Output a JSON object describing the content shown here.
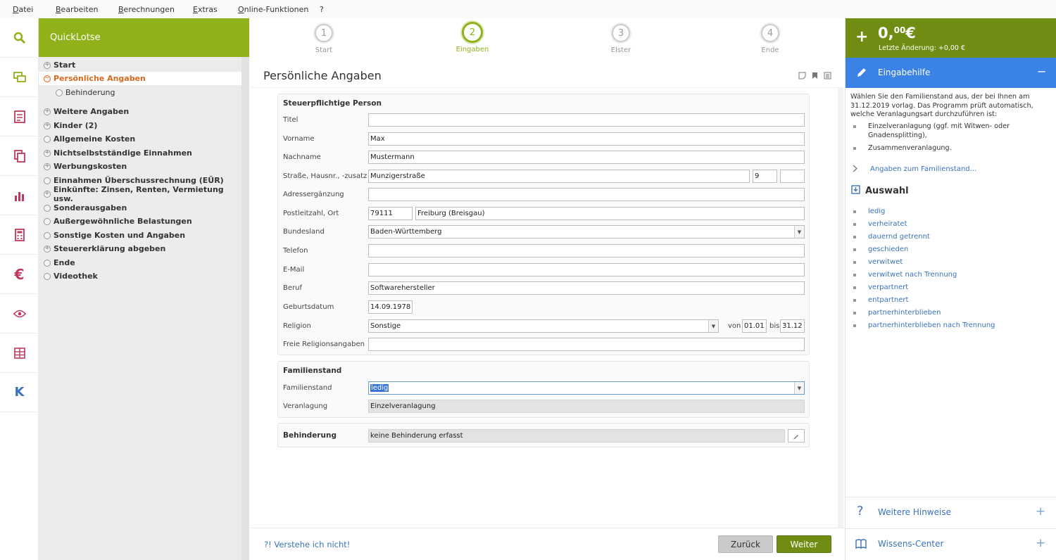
{
  "menu": [
    "Datei",
    "Bearbeiten",
    "Berechnungen",
    "Extras",
    "Online-Funktionen",
    "?"
  ],
  "sidebar_icons": [
    "search-icon",
    "chat-icon",
    "form-icon",
    "documents-icon",
    "chart-icon",
    "calculator-icon",
    "euro-icon",
    "eye-icon",
    "grid-icon",
    "k-icon"
  ],
  "quicklotse": {
    "title": "QuickLotse",
    "items": [
      {
        "label": "Start",
        "node": "+",
        "sub": false,
        "current": false
      },
      {
        "label": "Persönliche Angaben",
        "node": "−",
        "sub": false,
        "current": true
      },
      {
        "label": "Behinderung",
        "node": "",
        "sub": true,
        "current": false
      },
      {
        "label": "Weitere Angaben",
        "node": "+",
        "sub": false,
        "current": false
      },
      {
        "label": "Kinder (2)",
        "node": "+",
        "sub": false,
        "current": false
      },
      {
        "label": "Allgemeine Kosten",
        "node": "",
        "sub": false,
        "current": false
      },
      {
        "label": "Nichtselbstständige Einnahmen",
        "node": "+",
        "sub": false,
        "current": false
      },
      {
        "label": "Werbungskosten",
        "node": "+",
        "sub": false,
        "current": false
      },
      {
        "label": "Einnahmen Überschussrechnung (EÜR)",
        "node": "",
        "sub": false,
        "current": false
      },
      {
        "label": "Einkünfte: Zinsen, Renten, Vermietung usw.",
        "node": "+",
        "sub": false,
        "current": false
      },
      {
        "label": "Sonderausgaben",
        "node": "",
        "sub": false,
        "current": false
      },
      {
        "label": "Außergewöhnliche Belastungen",
        "node": "",
        "sub": false,
        "current": false
      },
      {
        "label": "Sonstige Kosten und Angaben",
        "node": "",
        "sub": false,
        "current": false
      },
      {
        "label": "Steuererklärung abgeben",
        "node": "+",
        "sub": false,
        "current": false
      },
      {
        "label": "Ende",
        "node": "",
        "sub": false,
        "current": false
      },
      {
        "label": "Videothek",
        "node": "",
        "sub": false,
        "current": false
      }
    ]
  },
  "steps": [
    {
      "num": "1",
      "label": "Start"
    },
    {
      "num": "2",
      "label": "Eingaben"
    },
    {
      "num": "3",
      "label": "Elster"
    },
    {
      "num": "4",
      "label": "Ende"
    }
  ],
  "page_title": "Persönliche Angaben",
  "person": {
    "title": "Steuerpflichtige Person",
    "labels": {
      "titel": "Titel",
      "vorname": "Vorname",
      "nachname": "Nachname",
      "strasse": "Straße, Hausnr., -zusatz",
      "adresse": "Adressergänzung",
      "plz": "Postleitzahl, Ort",
      "bundesland": "Bundesland",
      "telefon": "Telefon",
      "email": "E-Mail",
      "beruf": "Beruf",
      "geburt": "Geburtsdatum",
      "religion": "Religion",
      "freie": "Freie Religionsangaben"
    },
    "values": {
      "titel": "",
      "vorname": "Max",
      "nachname": "Mustermann",
      "strasse": "Munzigerstraße",
      "hausnr": "9",
      "zusatz": "",
      "adresse": "",
      "plz": "79111",
      "ort": "Freiburg (Breisgau)",
      "bundesland": "Baden-Württemberg",
      "telefon": "",
      "email": "",
      "beruf": "Softwarehersteller",
      "geburt": "14.09.1978",
      "religion": "Sonstige",
      "von_label": "von",
      "von": "01.01",
      "bis_label": "bis",
      "bis": "31.12",
      "freie": ""
    }
  },
  "familienstand": {
    "title": "Familienstand",
    "label_stand": "Familienstand",
    "value_stand": "ledig",
    "label_veranlagung": "Veranlagung",
    "value_veranlagung": "Einzelveranlagung"
  },
  "behinderung": {
    "title": "Behinderung",
    "value": "keine Behinderung erfasst"
  },
  "footer": {
    "help": "?! Verstehe ich nicht!",
    "back": "Zurück",
    "next": "Weiter"
  },
  "right": {
    "plus": "+",
    "amount_main": "0,",
    "amount_cents": "00",
    "amount_currency": "€",
    "last_change": "Letzte Änderung: +0,00 €",
    "help_title": "Eingabehilfe",
    "help_minimize": "−",
    "help_text": "Wählen Sie den Familienstand aus, der bei Ihnen am 31.12.2019 vorlag. Das Programm prüft automatisch, welche Veranlagungsart durchzuführen ist:",
    "help_bullets": [
      "Einzelveranlagung (ggf. mit Witwen- oder Gnadensplitting),",
      "Zusammenveranlagung."
    ],
    "more_link": "Angaben zum Familienstand...",
    "auswahl_title": "Auswahl",
    "choices": [
      "ledig",
      "verheiratet",
      "dauernd getrennt",
      "geschieden",
      "verwitwet",
      "verwitwet nach Trennung",
      "verpartnert",
      "entpartnert",
      "partnerhinterblieben",
      "partnerhinterblieben nach Trennung"
    ],
    "weitere": "Weitere Hinweise",
    "wissen": "Wissens-Center",
    "expand": "+"
  }
}
